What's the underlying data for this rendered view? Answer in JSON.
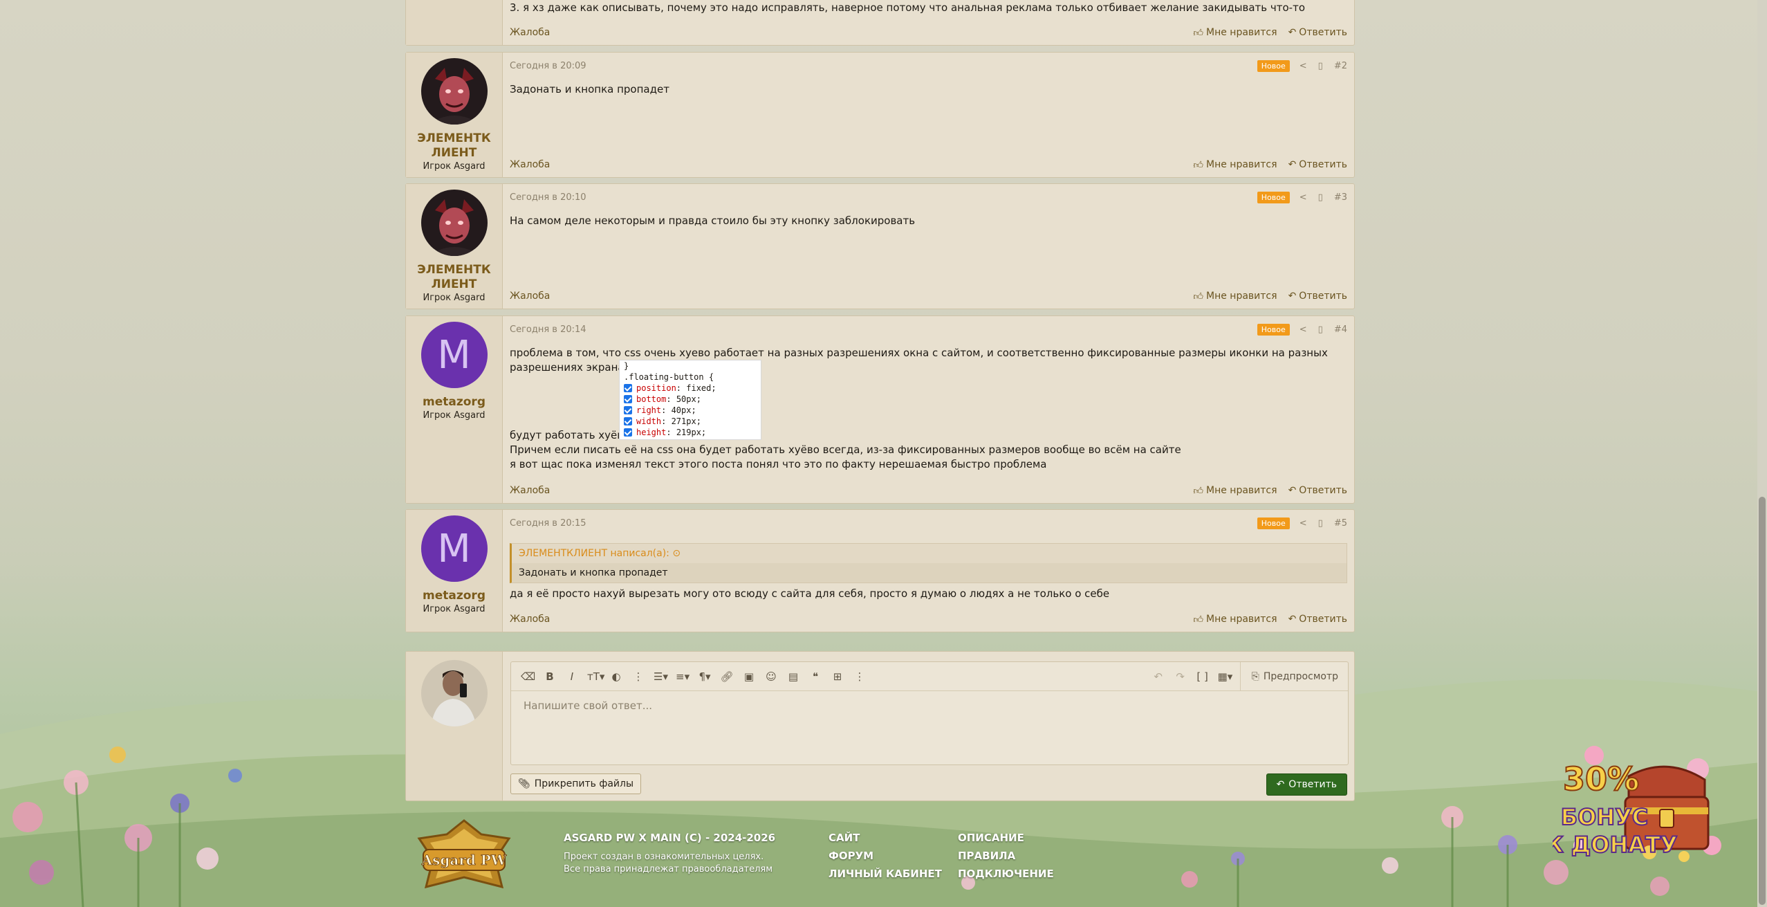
{
  "posts": [
    {
      "date": "",
      "text": "3. я хз даже как описывать, почему это надо исправлять, наверное потому что анальная реклама только отбивает желание закидывать что-то",
      "report": "Жалоба",
      "like": "Мне нравится",
      "reply": "Ответить"
    },
    {
      "author": "ЭЛЕМЕНТКЛИЕНТ",
      "role": "Игрок Asgard",
      "date": "Сегодня в 20:09",
      "badge": "Новое",
      "num": "#2",
      "text": "Задонать и кнопка пропадет",
      "report": "Жалоба",
      "like": "Мне нравится",
      "reply": "Ответить"
    },
    {
      "author": "ЭЛЕМЕНТКЛИЕНТ",
      "role": "Игрок Asgard",
      "date": "Сегодня в 20:10",
      "badge": "Новое",
      "num": "#3",
      "text": "На самом деле некоторым и правда стоило бы эту кнопку заблокировать",
      "report": "Жалоба",
      "like": "Мне нравится",
      "reply": "Ответить"
    },
    {
      "author": "metazorg",
      "role": "Игрок Asgard",
      "avatar_letter": "M",
      "date": "Сегодня в 20:14",
      "badge": "Новое",
      "num": "#4",
      "text1": "проблема в том, что css очень хуево работает на разных разрешениях окна с сайтом, и соответственно фиксированные размеры иконки на разных разрешениях экрана",
      "text2": "будут работать хуёво:",
      "text3": "Причем если писать её на css она будет работать хуёво всегда, из-за фиксированных размеров вообще во всём на сайте",
      "text4": "я вот щас пока изменял текст этого поста понял что это по факту нерешаемая быстро проблема",
      "report": "Жалоба",
      "like": "Мне нравится",
      "reply": "Ответить"
    },
    {
      "author": "metazorg",
      "role": "Игрок Asgard",
      "avatar_letter": "M",
      "date": "Сегодня в 20:15",
      "badge": "Новое",
      "num": "#5",
      "quote_author": "ЭЛЕМЕНТКЛИЕНТ написал(а):",
      "quote_text": "Задонать и кнопка пропадет",
      "text": "да я её просто нахуй вырезать могу ото всюду с сайта для себя, просто я думаю о людях а не только о себе",
      "report": "Жалоба",
      "like": "Мне нравится",
      "reply": "Ответить"
    }
  ],
  "css_snippet": {
    "top": "}",
    "selector": ".floating-button {",
    "lines": [
      {
        "prop": "position",
        "val": "fixed;"
      },
      {
        "prop": "bottom",
        "val": "50px;"
      },
      {
        "prop": "right",
        "val": "40px;"
      },
      {
        "prop": "width",
        "val": "271px;"
      },
      {
        "prop": "height",
        "val": "219px;"
      }
    ]
  },
  "editor": {
    "placeholder": "Напишите свой ответ...",
    "preview": "Предпросмотр",
    "attach": "Прикрепить файлы",
    "submit": "Ответить"
  },
  "footer": {
    "copyright": "ASGARD PW X MAIN (C) - 2024-2026",
    "note1": "Проект создан в ознакомительных целях.",
    "note2": "Все права принадлежат правообладателям",
    "col1": [
      "САЙТ",
      "ФОРУМ",
      "ЛИЧНЫЙ КАБИНЕТ"
    ],
    "col2": [
      "ОПИСАНИЕ",
      "ПРАВИЛА",
      "ПОДКЛЮЧЕНИЕ"
    ],
    "logo_text": "Asgard PW"
  },
  "promo": {
    "percent": "30%",
    "line1": "БОНУС",
    "line2": "К ДОНАТУ"
  },
  "colors": {
    "accent": "#7b5b1b",
    "badge": "#f29a1a",
    "submit": "#2f6a1f",
    "avatar_m": "#6a31ad"
  }
}
